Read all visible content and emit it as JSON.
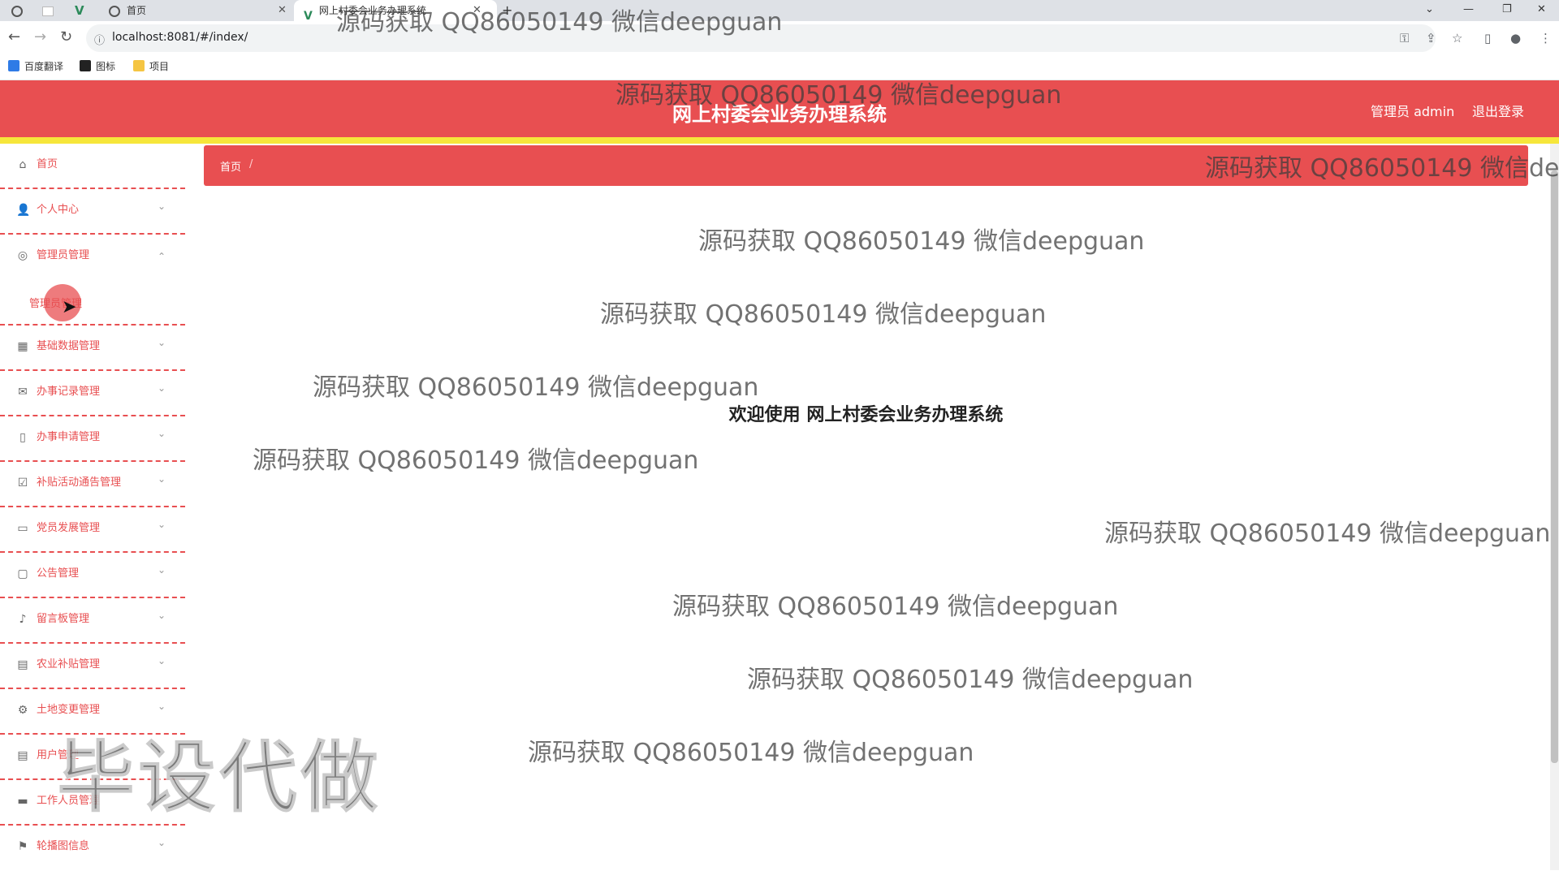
{
  "browser": {
    "tabs": [
      {
        "label": ""
      },
      {
        "label": ""
      },
      {
        "label": ""
      },
      {
        "label": "首页"
      },
      {
        "label": "网上村委会业务办理系统"
      }
    ],
    "new_tab": "+",
    "url": "localhost:8081/#/index/",
    "bookmarks": [
      {
        "label": "百度翻译"
      },
      {
        "label": "图标"
      },
      {
        "label": "项目"
      }
    ]
  },
  "header": {
    "title": "网上村委会业务办理系统",
    "user_label": "管理员 admin",
    "logout": "退出登录",
    "accent_color": "#e84f51",
    "stripe_color": "#f6e63b"
  },
  "sidebar": {
    "items": [
      {
        "label": "首页",
        "icon": "home-icon",
        "arrow": ""
      },
      {
        "label": "个人中心",
        "icon": "user-icon",
        "arrow": "⌄"
      },
      {
        "label": "管理员管理",
        "icon": "admin-icon",
        "arrow": "⌃"
      },
      {
        "label": "管理员管理",
        "icon": "",
        "arrow": ""
      },
      {
        "label": "基础数据管理",
        "icon": "grid-icon",
        "arrow": "⌄"
      },
      {
        "label": "办事记录管理",
        "icon": "mail-icon",
        "arrow": "⌄"
      },
      {
        "label": "办事申请管理",
        "icon": "phone-icon",
        "arrow": "⌄"
      },
      {
        "label": "补贴活动通告管理",
        "icon": "clipboard-icon",
        "arrow": "⌄"
      },
      {
        "label": "党员发展管理",
        "icon": "monitor-icon",
        "arrow": "⌄"
      },
      {
        "label": "公告管理",
        "icon": "chat-icon",
        "arrow": "⌄"
      },
      {
        "label": "留言板管理",
        "icon": "bell-icon",
        "arrow": "⌄"
      },
      {
        "label": "农业补贴管理",
        "icon": "clipboard-icon",
        "arrow": "⌄"
      },
      {
        "label": "土地变更管理",
        "icon": "gear-icon",
        "arrow": "⌄"
      },
      {
        "label": "用户管理",
        "icon": "doc-icon",
        "arrow": "⌄"
      },
      {
        "label": "工作人员管理",
        "icon": "camera-icon",
        "arrow": "⌄"
      },
      {
        "label": "轮播图信息",
        "icon": "flag-icon",
        "arrow": "⌄"
      }
    ]
  },
  "breadcrumb": {
    "home": "首页",
    "separator": "/"
  },
  "main": {
    "welcome": "欢迎使用 网上村委会业务办理系统"
  },
  "watermarks": {
    "text": "源码获取 QQ86050149 微信deepguan",
    "partial": "源码获取 QQ86050149 微信dee",
    "tab_overlay": "源码获取 QQ86050149 微信deepguan",
    "big": "毕设代做"
  }
}
